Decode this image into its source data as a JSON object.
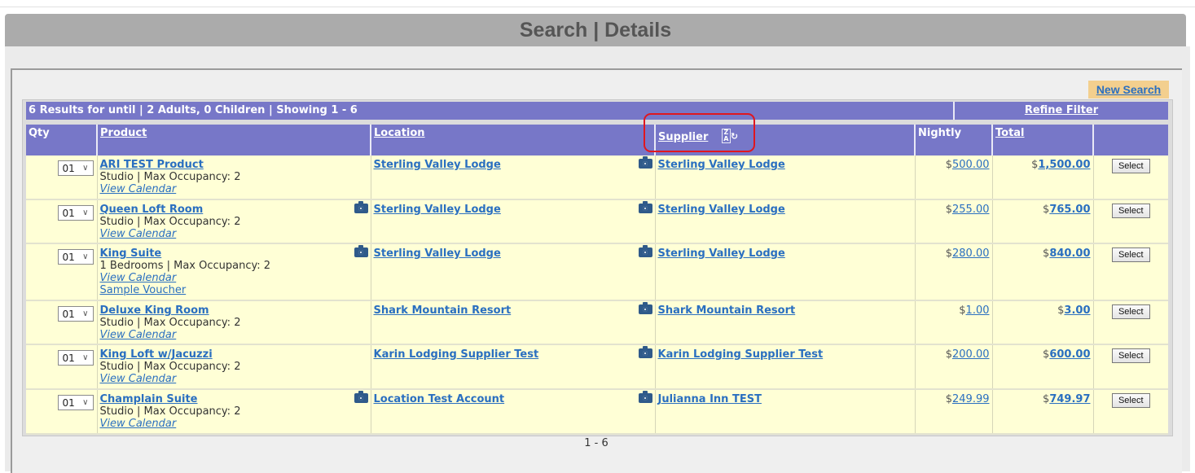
{
  "page": {
    "title": "Search | Details"
  },
  "toolbar": {
    "new_search": "New Search"
  },
  "summary": {
    "results_text": "6 Results for until | 2 Adults, 0 Children | Showing 1 - 6",
    "refine_filter": "Refine Filter"
  },
  "columns": {
    "qty": "Qty",
    "product": "Product",
    "location": "Location",
    "supplier": "Supplier",
    "nightly": "Nightly",
    "total": "Total"
  },
  "sort_icon": "sort-za-icon",
  "rows": [
    {
      "qty": "01",
      "product": "ARI TEST Product",
      "detail": "Studio | Max Occupancy: 2",
      "calendar": "View Calendar",
      "voucher": "",
      "product_camera": false,
      "location": "Sterling Valley Lodge",
      "supplier": "Sterling Valley Lodge",
      "currency": "$",
      "nightly": "500.00",
      "total": "1,500.00",
      "select": "Select"
    },
    {
      "qty": "01",
      "product": "Queen Loft Room",
      "detail": "Studio | Max Occupancy: 2",
      "calendar": "View Calendar",
      "voucher": "",
      "product_camera": true,
      "location": "Sterling Valley Lodge",
      "supplier": "Sterling Valley Lodge",
      "currency": "$",
      "nightly": "255.00",
      "total": "765.00",
      "select": "Select"
    },
    {
      "qty": "01",
      "product": "King Suite",
      "detail": "1 Bedrooms | Max Occupancy: 2",
      "calendar": "View Calendar",
      "voucher": "Sample Voucher",
      "product_camera": true,
      "location": "Sterling Valley Lodge",
      "supplier": "Sterling Valley Lodge",
      "currency": "$",
      "nightly": "280.00",
      "total": "840.00",
      "select": "Select"
    },
    {
      "qty": "01",
      "product": "Deluxe King Room",
      "detail": "Studio | Max Occupancy: 2",
      "calendar": "View Calendar",
      "voucher": "",
      "product_camera": false,
      "location": "Shark Mountain Resort",
      "supplier": "Shark Mountain Resort",
      "currency": "$",
      "nightly": "1.00",
      "total": "3.00",
      "select": "Select"
    },
    {
      "qty": "01",
      "product": "King Loft w/Jacuzzi",
      "detail": "Studio | Max Occupancy: 2",
      "calendar": "View Calendar",
      "voucher": "",
      "product_camera": false,
      "location": "Karin Lodging Supplier Test",
      "supplier": "Karin Lodging Supplier Test",
      "currency": "$",
      "nightly": "200.00",
      "total": "600.00",
      "select": "Select"
    },
    {
      "qty": "01",
      "product": "Champlain Suite",
      "detail": "Studio | Max Occupancy: 2",
      "calendar": "View Calendar",
      "voucher": "",
      "product_camera": true,
      "location": "Location Test Account",
      "supplier": "Julianna Inn TEST",
      "currency": "$",
      "nightly": "249.99",
      "total": "749.97",
      "select": "Select"
    }
  ],
  "pager": {
    "text": "1 - 6"
  },
  "colors": {
    "header": "#7777c8",
    "row": "#ffffd6",
    "link": "#2a6fc0",
    "button_new_search": "#f3cf8e",
    "highlight": "#e0161f"
  }
}
